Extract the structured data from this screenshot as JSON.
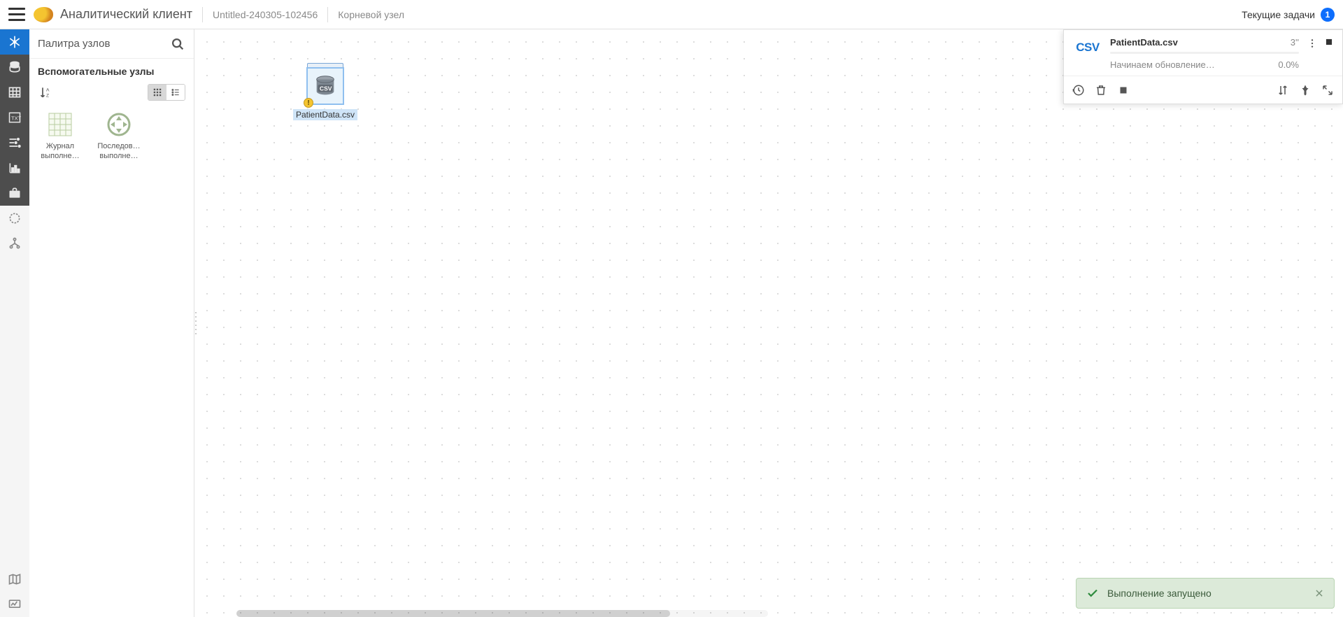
{
  "header": {
    "app_title": "Аналитический клиент",
    "doc_title": "Untitled-240305-102456",
    "breadcrumb": "Корневой узел",
    "tasks_label": "Текущие задачи",
    "tasks_count": "1"
  },
  "palette": {
    "title": "Палитра узлов",
    "section": "Вспомогательные узлы",
    "items": [
      {
        "label_line1": "Журнал",
        "label_line2": "выполне…"
      },
      {
        "label_line1": "Последов…",
        "label_line2": "выполне…"
      }
    ]
  },
  "canvas": {
    "node_label": "PatientData.csv",
    "node_warn": "!"
  },
  "task": {
    "icon_text": "CSV",
    "name": "PatientData.csv",
    "time": "3''",
    "status": "Начинаем обновление…",
    "pct": "0.0%"
  },
  "toast": {
    "text": "Выполнение запущено"
  }
}
